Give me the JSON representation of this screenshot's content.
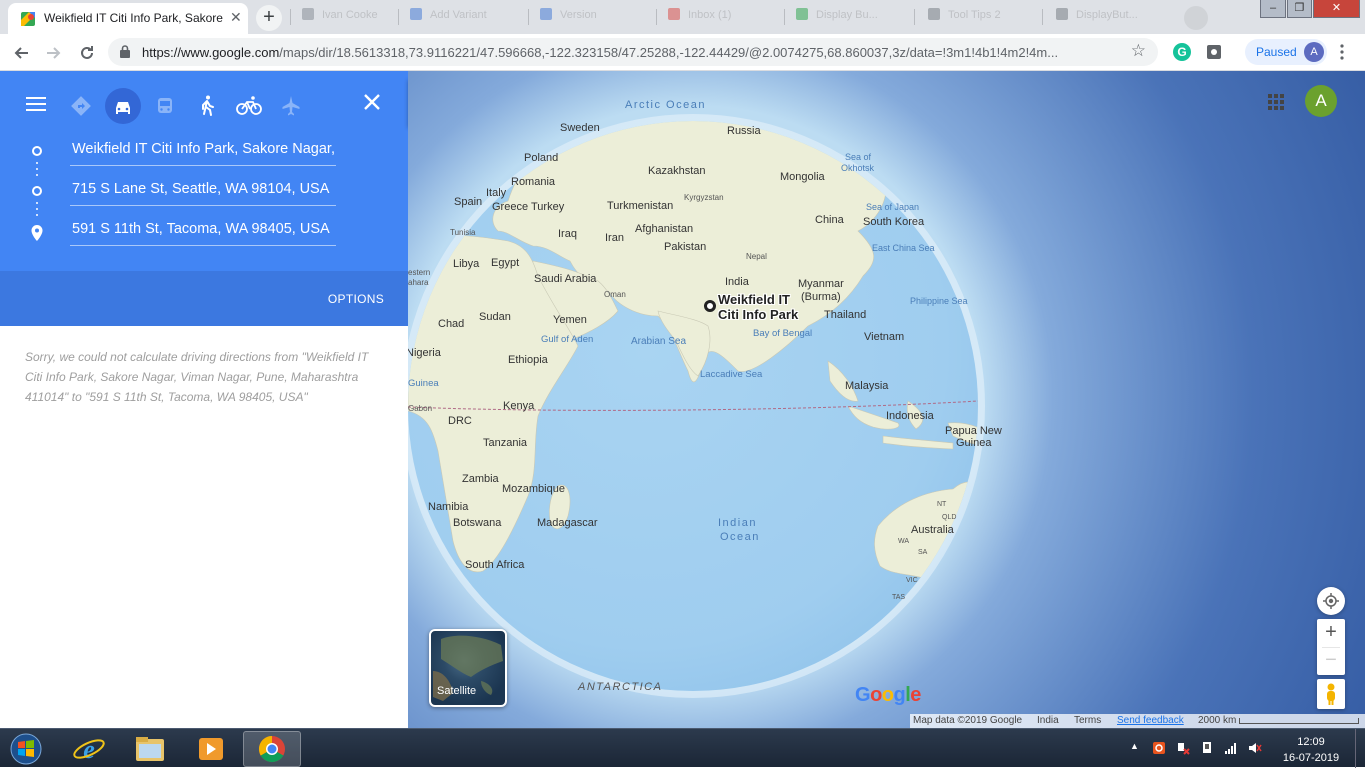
{
  "browser": {
    "active_tab": {
      "title": "Weikfield IT Citi Info Park, Sakore Nagar, Viman Nagar, Pune"
    },
    "background_tabs": [
      "Ivan Cooke",
      "Add Variant",
      "Version",
      "Inbox (1)",
      "Display Bu...",
      "Tool Tips 2",
      "DisplayBut..."
    ],
    "url_host": "https://www.google.com",
    "url_path": "/maps/dir/18.5613318,73.9116221/47.596668,-122.323158/47.25288,-122.44429/@2.0074275,68.860037,3z/data=!3m1!4b1!4m2!4m...",
    "paused_label": "Paused",
    "profile_initial": "A"
  },
  "panel": {
    "waypoints": [
      {
        "value": "Weikfield IT Citi Info Park, Sakore Nagar, Viman Nagar, Pune, Maharashtra 411014"
      },
      {
        "value": "715 S Lane St, Seattle, WA 98104, USA"
      },
      {
        "value": "591 S 11th St, Tacoma, WA 98405, USA"
      }
    ],
    "options_label": "OPTIONS",
    "error_message": "Sorry, we could not calculate driving directions from \"Weikfield IT Citi Info Park, Sakore Nagar, Viman Nagar, Pune, Maharashtra 411014\" to \"591 S 11th St, Tacoma, WA 98405, USA\"",
    "travel_modes": [
      "directions-icon",
      "car-icon",
      "transit-icon",
      "walk-icon",
      "bicycle-icon",
      "flight-icon"
    ],
    "selected_mode": "car-icon"
  },
  "map": {
    "pin_label_line1": "Weikfield IT",
    "pin_label_line2": "Citi Info Park",
    "account_initial": "A",
    "satellite_label": "Satellite",
    "google_logo": "Google",
    "ocean_labels": {
      "arctic": "Arctic Ocean",
      "indian_1": "Indian",
      "indian_2": "Ocean",
      "antarctica": "ANTARCTICA"
    },
    "countries": [
      "Sweden",
      "Russia",
      "Poland",
      "Kazakhstan",
      "Mongolia",
      "Romania",
      "Kyrgyzstan",
      "Italy",
      "Spain",
      "Greece",
      "Turkey",
      "Turkmenistan",
      "China",
      "South Korea",
      "Afghanistan",
      "Tunisia",
      "Iraq",
      "Iran",
      "Pakistan",
      "Nepal",
      "Libya",
      "Egypt",
      "Saudi Arabia",
      "India",
      "Myanmar",
      "(Burma)",
      "Oman",
      "Chad",
      "Sudan",
      "Yemen",
      "Thailand",
      "Vietnam",
      "Nigeria",
      "Ethiopia",
      "Malaysia",
      "Kenya",
      "Gabon",
      "DRC",
      "Indonesia",
      "Papua New",
      "Guinea",
      "Tanzania",
      "Zambia",
      "Mozambique",
      "Namibia",
      "Botswana",
      "Madagascar",
      "South Africa",
      "Australia",
      "estern",
      "ahara"
    ],
    "seas": [
      "Sea of",
      "Okhotsk",
      "Sea of Japan",
      "East China Sea",
      "Philippine Sea",
      "Bay of Bengal",
      "Gulf of Aden",
      "Arabian Sea",
      "Laccadive Sea",
      "Guinea"
    ],
    "states": [
      "NT",
      "QLD",
      "WA",
      "SA",
      "VIC",
      "TAS"
    ],
    "attribution": {
      "data": "Map data ©2019 Google",
      "region": "India",
      "terms": "Terms",
      "feedback": "Send feedback",
      "scale": "2000 km"
    }
  },
  "taskbar": {
    "time": "12:09",
    "date": "16-07-2019"
  }
}
